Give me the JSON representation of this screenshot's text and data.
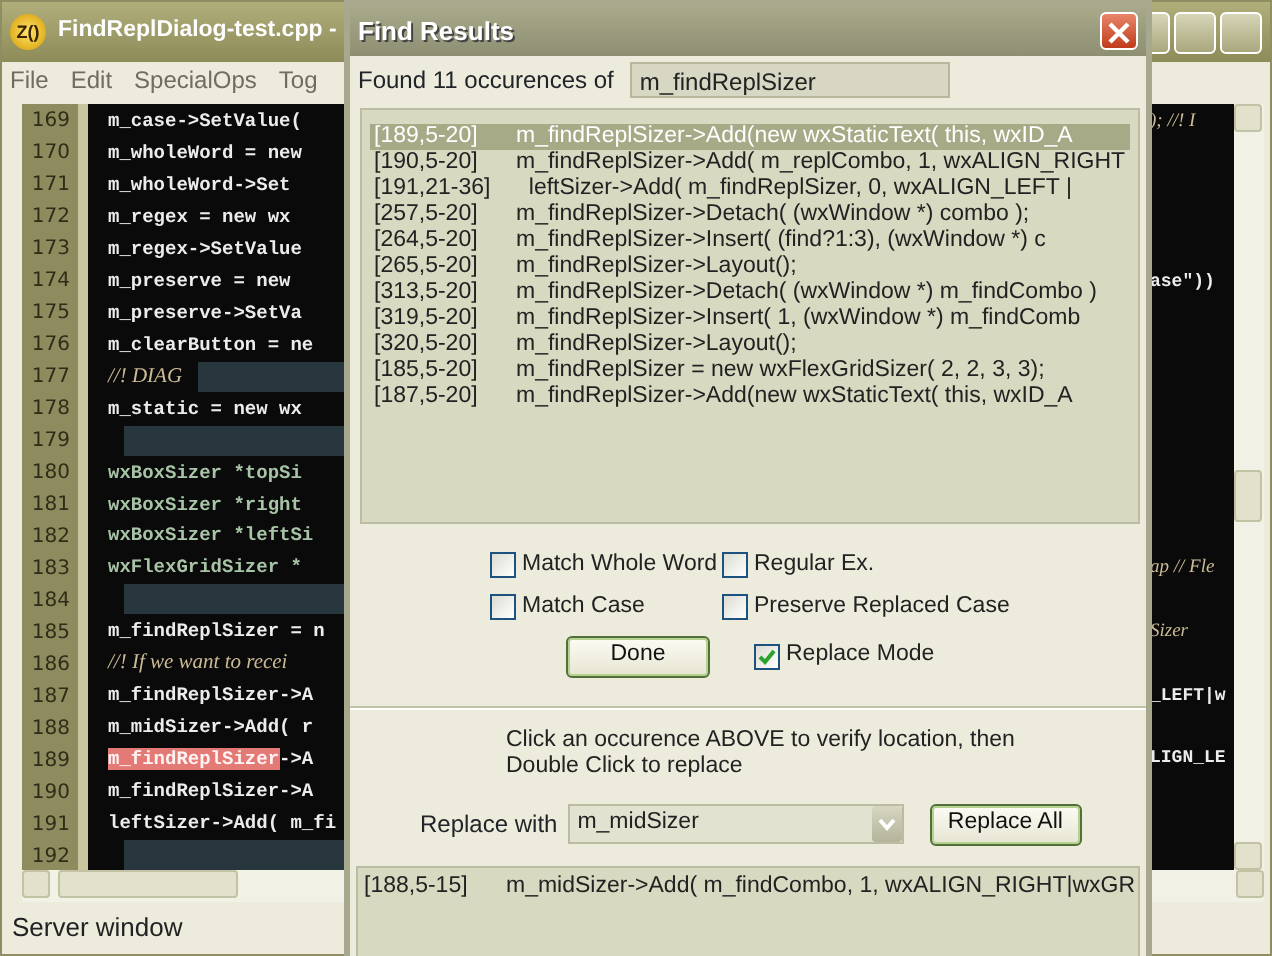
{
  "window": {
    "icon_label": "Z()",
    "title": "FindReplDialog-test.cpp -"
  },
  "menu": [
    "File",
    "Edit",
    "SpecialOps",
    "Tog"
  ],
  "editor": {
    "lines": [
      {
        "number": "169",
        "kind": "code",
        "text": "m_case->SetValue(",
        "right": {
          "text": "); //! I",
          "kind": "comment"
        }
      },
      {
        "number": "170",
        "kind": "code",
        "text": "m_wholeWord = new"
      },
      {
        "number": "171",
        "kind": "code",
        "text": "m_wholeWord->Set"
      },
      {
        "number": "172",
        "kind": "code",
        "text": "m_regex = new wx"
      },
      {
        "number": "173",
        "kind": "code",
        "text": "m_regex->SetValue"
      },
      {
        "number": "174",
        "kind": "code",
        "text": "m_preserve = new",
        "right": {
          "text": "ase\"))",
          "kind": "code"
        }
      },
      {
        "number": "175",
        "kind": "code",
        "text": "m_preserve->SetVa"
      },
      {
        "number": "176",
        "kind": "code",
        "text": "m_clearButton = ne"
      },
      {
        "number": "177",
        "kind": "comment",
        "text": "//! DIAG",
        "shaded": true
      },
      {
        "number": "178",
        "kind": "code",
        "text": "m_static = new wx"
      },
      {
        "number": "179",
        "kind": "code",
        "shaded": true
      },
      {
        "number": "180",
        "kind": "type",
        "text": "wxBoxSizer *topSi"
      },
      {
        "number": "181",
        "kind": "type",
        "text": "wxBoxSizer *right"
      },
      {
        "number": "182",
        "kind": "type",
        "text": "wxBoxSizer *leftSi"
      },
      {
        "number": "183",
        "kind": "type",
        "text": "wxFlexGridSizer *",
        "right": {
          "text": "ap // Fle",
          "kind": "comment"
        }
      },
      {
        "number": "184",
        "kind": "code",
        "shaded": true
      },
      {
        "number": "185",
        "kind": "code",
        "text": "m_findReplSizer = n",
        "right": {
          "text": "Sizer",
          "kind": "comment"
        }
      },
      {
        "number": "186",
        "kind": "comment",
        "text": "//! If we want to recei"
      },
      {
        "number": "187",
        "kind": "code",
        "text": "m_findReplSizer->A",
        "right": {
          "text": "_LEFT|w",
          "kind": "code"
        }
      },
      {
        "number": "188",
        "kind": "code",
        "text": "m_midSizer->Add( r"
      },
      {
        "number": "189",
        "kind": "code",
        "match": "m_findReplSizer",
        "text": "->A",
        "right": {
          "text": "LIGN_LE",
          "kind": "code"
        }
      },
      {
        "number": "190",
        "kind": "code",
        "text": "m_findReplSizer->A"
      },
      {
        "number": "191",
        "kind": "code",
        "text": "leftSizer->Add( m_fi"
      },
      {
        "number": "192",
        "kind": "code",
        "shaded": true
      }
    ]
  },
  "status_bar": "Server window",
  "dialog": {
    "title": "Find Results",
    "found_label": "Found 11 occurences of",
    "search_term": "m_findReplSizer",
    "results": [
      {
        "location": "[189,5-20]",
        "code": "m_findReplSizer->Add(new wxStaticText( this, wxID_A",
        "selected": true
      },
      {
        "location": "[190,5-20]",
        "code": "m_findReplSizer->Add( m_replCombo, 1, wxALIGN_RIGHT",
        "selected": false
      },
      {
        "location": "[191,21-36]",
        "code": "  leftSizer->Add( m_findReplSizer, 0, wxALIGN_LEFT |",
        "selected": false
      },
      {
        "location": "[257,5-20]",
        "code": "m_findReplSizer->Detach( (wxWindow *) combo );",
        "selected": false
      },
      {
        "location": "[264,5-20]",
        "code": "m_findReplSizer->Insert( (find?1:3), (wxWindow *) c",
        "selected": false
      },
      {
        "location": "[265,5-20]",
        "code": "m_findReplSizer->Layout();",
        "selected": false
      },
      {
        "location": "[313,5-20]",
        "code": "m_findReplSizer->Detach( (wxWindow *) m_findCombo )",
        "selected": false
      },
      {
        "location": "[319,5-20]",
        "code": "m_findReplSizer->Insert( 1, (wxWindow *) m_findComb",
        "selected": false
      },
      {
        "location": "[320,5-20]",
        "code": "m_findReplSizer->Layout();",
        "selected": false
      },
      {
        "location": "[185,5-20]",
        "code": "m_findReplSizer = new wxFlexGridSizer( 2, 2, 3, 3);",
        "selected": false
      },
      {
        "location": "[187,5-20]",
        "code": "m_findReplSizer->Add(new wxStaticText( this, wxID_A",
        "selected": false
      }
    ],
    "options": [
      {
        "label": "Match Whole Word",
        "checked": false
      },
      {
        "label": "Regular Ex.",
        "checked": false
      },
      {
        "label": "Match Case",
        "checked": false
      },
      {
        "label": "Preserve Replaced Case",
        "checked": false
      }
    ],
    "done_button": "Done",
    "replace_mode": {
      "label": "Replace Mode",
      "checked": true
    },
    "instructions": "Click an occurence ABOVE to verify location, then\nDouble Click to replace",
    "replace_label": "Replace with",
    "replace_value": "m_midSizer",
    "replace_all_button": "Replace All",
    "replacements": [
      {
        "location": "[188,5-15]",
        "code": "m_midSizer->Add( m_findCombo, 1, wxALIGN_RIGHT|wxGR"
      }
    ]
  }
}
